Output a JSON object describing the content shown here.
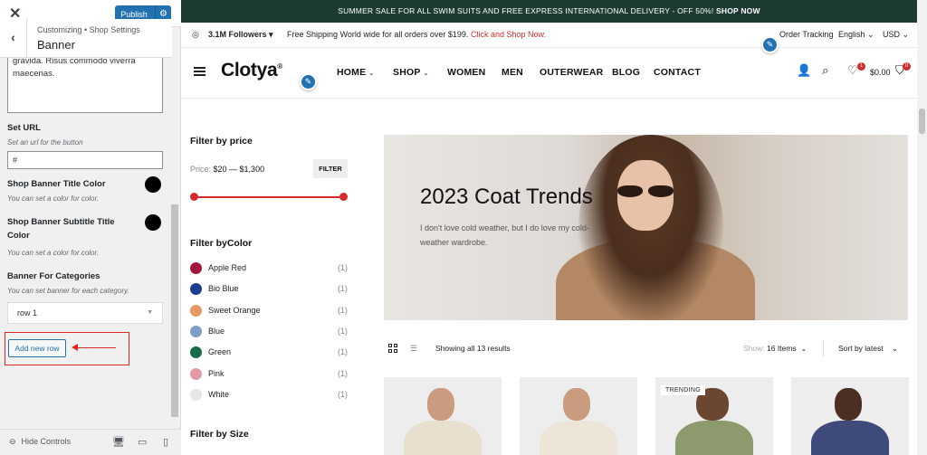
{
  "customizer": {
    "publish_label": "Publish",
    "breadcrumb": "Customizing • Shop Settings",
    "section_title": "Banner",
    "textarea_text": "gravida. Risus commodo viverra maecenas.",
    "fields": {
      "set_url_label": "Set URL",
      "set_url_desc": "Set an url for the button",
      "set_url_value": "#",
      "title_color_label": "Shop Banner Title Color",
      "title_color_desc": "You can set a color for color.",
      "subtitle_color_label": "Shop Banner Subtitle Title Color",
      "subtitle_color_desc": "You can set a color for color.",
      "categories_label": "Banner For Categories",
      "categories_desc": "You can set banner for each category.",
      "row_select_value": "row 1",
      "add_row_label": "Add new row"
    },
    "hide_controls_label": "Hide Controls",
    "colors": {
      "publish": "#2271b1",
      "swatch": "#000000",
      "annotation": "#e02424"
    }
  },
  "site": {
    "promo_text": "SUMMER SALE FOR ALL SWIM SUITS AND FREE EXPRESS INTERNATIONAL DELIVERY - OFF 50%!",
    "promo_link": "SHOP NOW",
    "followers": "3.1M Followers",
    "shipping_text": "Free Shipping World wide for all orders over $199.",
    "shipping_link": "Click and Shop Now.",
    "order_tracking": "Order Tracking",
    "language": "English",
    "currency": "USD",
    "logo": "Clotya",
    "logo_mark": "®",
    "nav": [
      "HOME",
      "SHOP",
      "WOMEN",
      "MEN",
      "OUTERWEAR",
      "BLOG",
      "CONTACT"
    ],
    "wishlist_count": "1",
    "cart_total": "$0.00",
    "cart_count": "0",
    "colors": {
      "promo_bg": "#1d3b33",
      "accent": "#d42a2a"
    }
  },
  "filters": {
    "price_title": "Filter by price",
    "price_label": "Price:",
    "price_range": "$20 — $1,300",
    "filter_button": "FILTER",
    "price_min": 20,
    "price_max": 1300,
    "color_title": "Filter byColor",
    "colors": [
      {
        "name": "Apple Red",
        "count": "(1)",
        "hex": "#a3163d"
      },
      {
        "name": "Bio Blue",
        "count": "(1)",
        "hex": "#1a3d8f"
      },
      {
        "name": "Sweet Orange",
        "count": "(1)",
        "hex": "#e59a63"
      },
      {
        "name": "Blue",
        "count": "(1)",
        "hex": "#7c9dc7"
      },
      {
        "name": "Green",
        "count": "(1)",
        "hex": "#176b47"
      },
      {
        "name": "Pink",
        "count": "(1)",
        "hex": "#e29aa6"
      },
      {
        "name": "White",
        "count": "(1)",
        "hex": "#e6e6e6"
      }
    ],
    "size_title": "Filter by Size"
  },
  "banner": {
    "title": "2023 Coat Trends",
    "subtitle": "I don't love cold weather, but I do love my cold-weather wardrobe."
  },
  "toolbar": {
    "showing": "Showing all 13 results",
    "show_label": "Show:",
    "show_value": "16 Items",
    "sort_value": "Sort by latest"
  },
  "products": {
    "badge": "TRENDING"
  }
}
